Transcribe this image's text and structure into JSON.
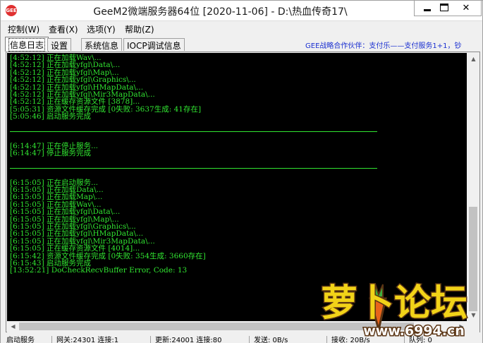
{
  "window": {
    "title": "GeeM2微端服务器64位 [2020-11-06] - D:\\热血传奇17\\",
    "icon_text": "GEE"
  },
  "menu": {
    "items": [
      "控制(W)",
      "查看(X)",
      "选项(Y)",
      "帮助(Z)"
    ]
  },
  "tabs": {
    "items": [
      "信息日志",
      "设置",
      "系统信息",
      "IOCP调试信息"
    ],
    "active": 0,
    "partner_text": "GEE战略合作伙伴：支付乐——支付服务1+1，钞"
  },
  "log": {
    "lines": [
      {
        "type": "text",
        "text": "[4:52:12] 正在加载Wav\\..."
      },
      {
        "type": "text",
        "text": "[4:52:12] 正在加载yfgl\\Data\\..."
      },
      {
        "type": "text",
        "text": "[4:52:12] 正在加载yfgl\\Map\\..."
      },
      {
        "type": "text",
        "text": "[4:52:12] 正在加载yfgl\\Graphics\\..."
      },
      {
        "type": "text",
        "text": "[4:52:12] 正在加载yfgl\\HMapData\\..."
      },
      {
        "type": "text",
        "text": "[4:52:12] 正在加载yfgl\\Mir3MapData\\..."
      },
      {
        "type": "text",
        "text": "[4:52:12] 正在缓存资源文件 [3878]..."
      },
      {
        "type": "text",
        "text": "[5:05:31] 资源文件缓存完成 [0失败: 3637生成: 41存在]"
      },
      {
        "type": "text",
        "text": "[5:05:46] 启动服务完成"
      },
      {
        "type": "blank",
        "text": ""
      },
      {
        "type": "sep",
        "text": ""
      },
      {
        "type": "blank",
        "text": ""
      },
      {
        "type": "text",
        "text": "[6:14:47] 正在停止服务..."
      },
      {
        "type": "text",
        "text": "[6:14:47] 停止服务完成"
      },
      {
        "type": "blank",
        "text": ""
      },
      {
        "type": "sep",
        "text": ""
      },
      {
        "type": "blank",
        "text": ""
      },
      {
        "type": "text",
        "text": "[6:15:05] 正在启动服务..."
      },
      {
        "type": "text",
        "text": "[6:15:05] 正在加载Data\\..."
      },
      {
        "type": "text",
        "text": "[6:15:05] 正在加载Map\\..."
      },
      {
        "type": "text",
        "text": "[6:15:05] 正在加载Wav\\..."
      },
      {
        "type": "text",
        "text": "[6:15:05] 正在加载yfgl\\Data\\..."
      },
      {
        "type": "text",
        "text": "[6:15:05] 正在加载yfgl\\Map\\..."
      },
      {
        "type": "text",
        "text": "[6:15:05] 正在加载yfgl\\Graphics\\..."
      },
      {
        "type": "text",
        "text": "[6:15:05] 正在加载yfgl\\HMapData\\..."
      },
      {
        "type": "text",
        "text": "[6:15:05] 正在加载yfgl\\Mir3MapData\\..."
      },
      {
        "type": "text",
        "text": "[6:15:05] 正在缓存资源文件 [4014]..."
      },
      {
        "type": "text",
        "text": "[6:15:42] 资源文件缓存完成 [0失败: 354生成: 3660存在]"
      },
      {
        "type": "text",
        "text": "[6:15:43] 启动服务完成"
      },
      {
        "type": "text",
        "text": "[13:52:21] DoCheckRecvBuffer Error, Code: 13"
      }
    ]
  },
  "statusbar": {
    "cells": [
      "启动服务",
      "网关:24301  连接:1",
      "更新:24001  连接:80",
      "发送: 0B/s",
      "接收: 20B/s",
      "队列: 0"
    ]
  },
  "watermark": {
    "brand": "萝卜论坛",
    "url": "www.6994.cn"
  },
  "colors": {
    "log_text": "#31e531",
    "log_bg": "#000000",
    "partner_link": "#1a2fd0",
    "watermark_fill": "#f2d318",
    "watermark_stroke": "#5a3413"
  }
}
